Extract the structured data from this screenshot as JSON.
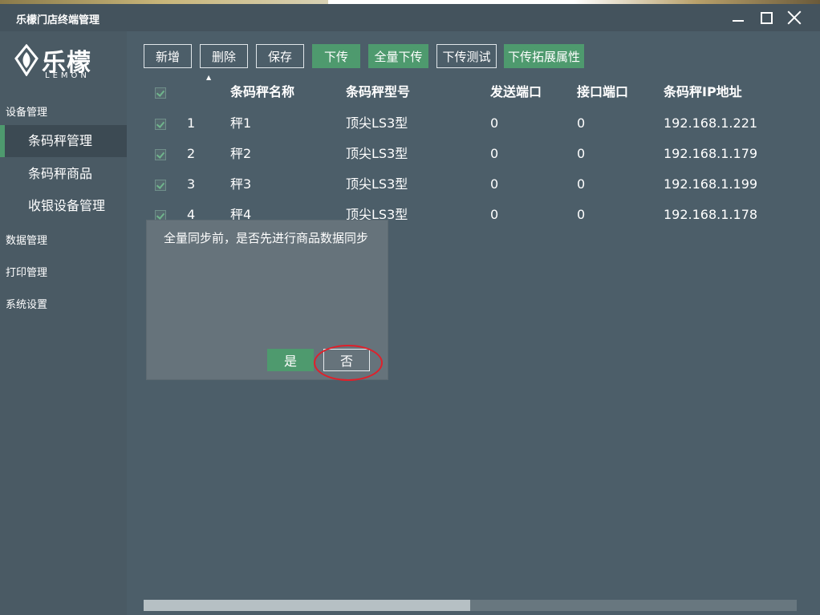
{
  "window": {
    "title": "乐檬门店终端管理"
  },
  "logo": {
    "cn": "乐檬",
    "en": "LEMON"
  },
  "sidebar": {
    "groups": [
      {
        "label": "设备管理"
      },
      {
        "label": "数据管理"
      },
      {
        "label": "打印管理"
      },
      {
        "label": "系统设置"
      }
    ],
    "items": [
      {
        "label": "条码秤管理",
        "active": true
      },
      {
        "label": "条码秤商品",
        "active": false
      },
      {
        "label": "收银设备管理",
        "active": false
      }
    ]
  },
  "toolbar": {
    "buttons": [
      {
        "label": "新增"
      },
      {
        "label": "删除"
      },
      {
        "label": "保存"
      },
      {
        "label": "下传"
      },
      {
        "label": "全量下传"
      },
      {
        "label": "下传测试"
      },
      {
        "label": "下传拓展属性"
      }
    ]
  },
  "table": {
    "columns": [
      "条码秤名称",
      "条码秤型号",
      "发送端口",
      "接口端口",
      "条码秤IP地址"
    ],
    "rows": [
      {
        "index": "1",
        "name": "秤1",
        "model": "顶尖LS3型",
        "send_port": "0",
        "iface_port": "0",
        "ip": "192.168.1.221",
        "checked": true
      },
      {
        "index": "2",
        "name": "秤2",
        "model": "顶尖LS3型",
        "send_port": "0",
        "iface_port": "0",
        "ip": "192.168.1.179",
        "checked": true
      },
      {
        "index": "3",
        "name": "秤3",
        "model": "顶尖LS3型",
        "send_port": "0",
        "iface_port": "0",
        "ip": "192.168.1.199",
        "checked": true
      },
      {
        "index": "4",
        "name": "秤4",
        "model": "顶尖LS3型",
        "send_port": "0",
        "iface_port": "0",
        "ip": "192.168.1.178",
        "checked": true
      }
    ]
  },
  "dialog": {
    "message": "全量同步前，是否先进行商品数据同步",
    "yes_label": "是",
    "no_label": "否"
  },
  "scrollbar": {
    "thumb_fraction": 0.5
  },
  "colors": {
    "accent_green": "#4e9a6e",
    "background": "#4c5e69",
    "highlight": "#e0202a"
  }
}
